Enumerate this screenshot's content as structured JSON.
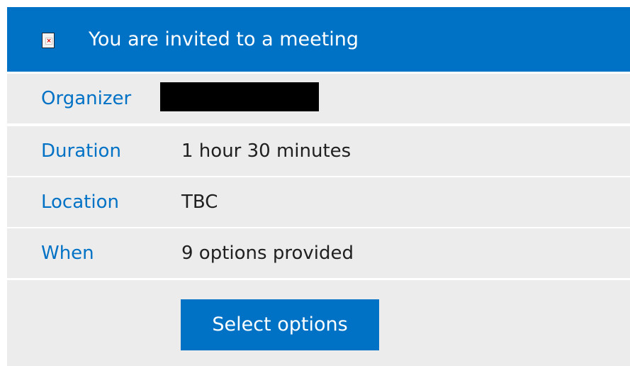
{
  "header": {
    "title": "You are invited to a meeting",
    "image_icon": "broken-image-icon"
  },
  "details": {
    "organizer": {
      "label": "Organizer",
      "value": ""
    },
    "duration": {
      "label": "Duration",
      "value": "1 hour 30 minutes"
    },
    "location": {
      "label": "Location",
      "value": "TBC"
    },
    "when": {
      "label": "When",
      "value": "9 options provided"
    }
  },
  "actions": {
    "select_options_label": "Select options"
  },
  "colors": {
    "accent": "#0072c6",
    "row_background": "#ececec",
    "text": "#202020",
    "header_text": "#ffffff"
  }
}
